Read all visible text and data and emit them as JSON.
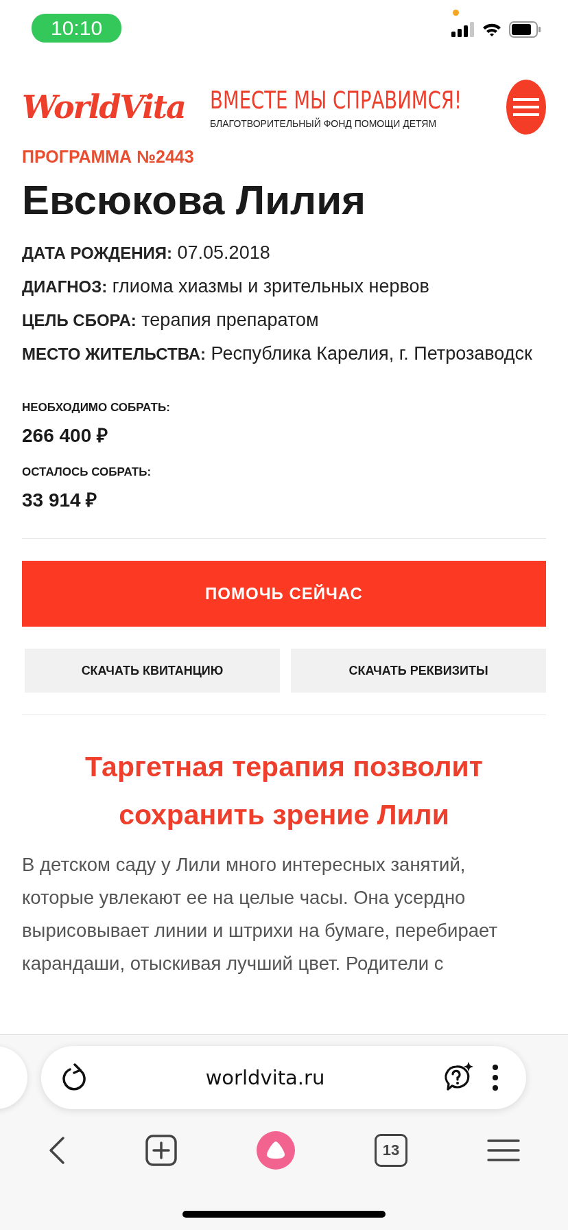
{
  "status_bar": {
    "time": "10:10"
  },
  "header": {
    "logo": "WorldVita",
    "slogan": "ВМЕСТЕ МЫ СПРАВИМСЯ!",
    "subtitle": "БЛАГОТВОРИТЕЛЬНЫЙ ФОНД ПОМОЩИ ДЕТЯМ"
  },
  "program": {
    "number": "ПРОГРАММА №2443",
    "name": "Евсюкова Лилия"
  },
  "details": [
    {
      "label": "ДАТА РОЖДЕНИЯ:",
      "value": "07.05.2018"
    },
    {
      "label": "ДИАГНОЗ:",
      "value": "глиома хиазмы и зрительных нервов"
    },
    {
      "label": "ЦЕЛЬ СБОРА:",
      "value": "терапия препаратом"
    },
    {
      "label": "МЕСТО ЖИТЕЛЬСТВА:",
      "value": "Республика Карелия, г. Петрозаводск"
    }
  ],
  "amounts": [
    {
      "label": "НЕОБХОДИМО СОБРАТЬ:",
      "value": "266 400 ₽"
    },
    {
      "label": "ОСТАЛОСЬ СОБРАТЬ:",
      "value": "33 914 ₽"
    }
  ],
  "help_button": "ПОМОЧЬ СЕЙЧАС",
  "secondary_buttons": [
    "СКАЧАТЬ КВИТАНЦИЮ",
    "СКАЧАТЬ РЕКВИЗИТЫ"
  ],
  "article": {
    "title": "Таргетная терапия позволит сохранить зрение Лили",
    "lines": [
      "В детском саду у Лили много интересных занятий,",
      "которые увлекают ее на целые часы. Она усердно",
      "вырисовывает линии и штрихи на бумаге, перебирает",
      "карандаши, отыскивая лучший цвет. Родители с"
    ]
  },
  "browser": {
    "address": "worldvita.ru",
    "tab_count": "13"
  }
}
